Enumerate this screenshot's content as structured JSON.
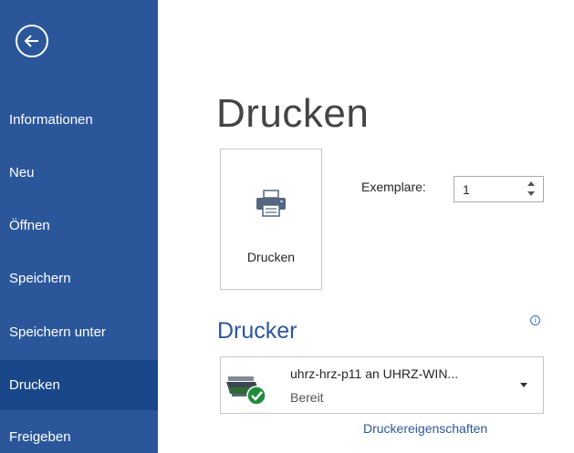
{
  "sidebar": {
    "items": [
      {
        "label": "Informationen"
      },
      {
        "label": "Neu"
      },
      {
        "label": "Öffnen"
      },
      {
        "label": "Speichern"
      },
      {
        "label": "Speichern unter"
      },
      {
        "label": "Drucken",
        "active": true
      },
      {
        "label": "Freigeben"
      }
    ]
  },
  "page": {
    "title": "Drucken"
  },
  "print_button": {
    "label": "Drucken",
    "icon": "printer-icon"
  },
  "copies": {
    "label": "Exemplare:",
    "value": "1"
  },
  "printer": {
    "section_title": "Drucker",
    "name": "uhrz-hrz-p11 an UHRZ-WIN...",
    "status": "Bereit",
    "properties_link": "Druckereigenschaften"
  },
  "colors": {
    "sidebar": "#2b579a",
    "sidebar_active": "#19478a",
    "accent": "#2b579a",
    "status_ok": "#1e8c3a"
  }
}
